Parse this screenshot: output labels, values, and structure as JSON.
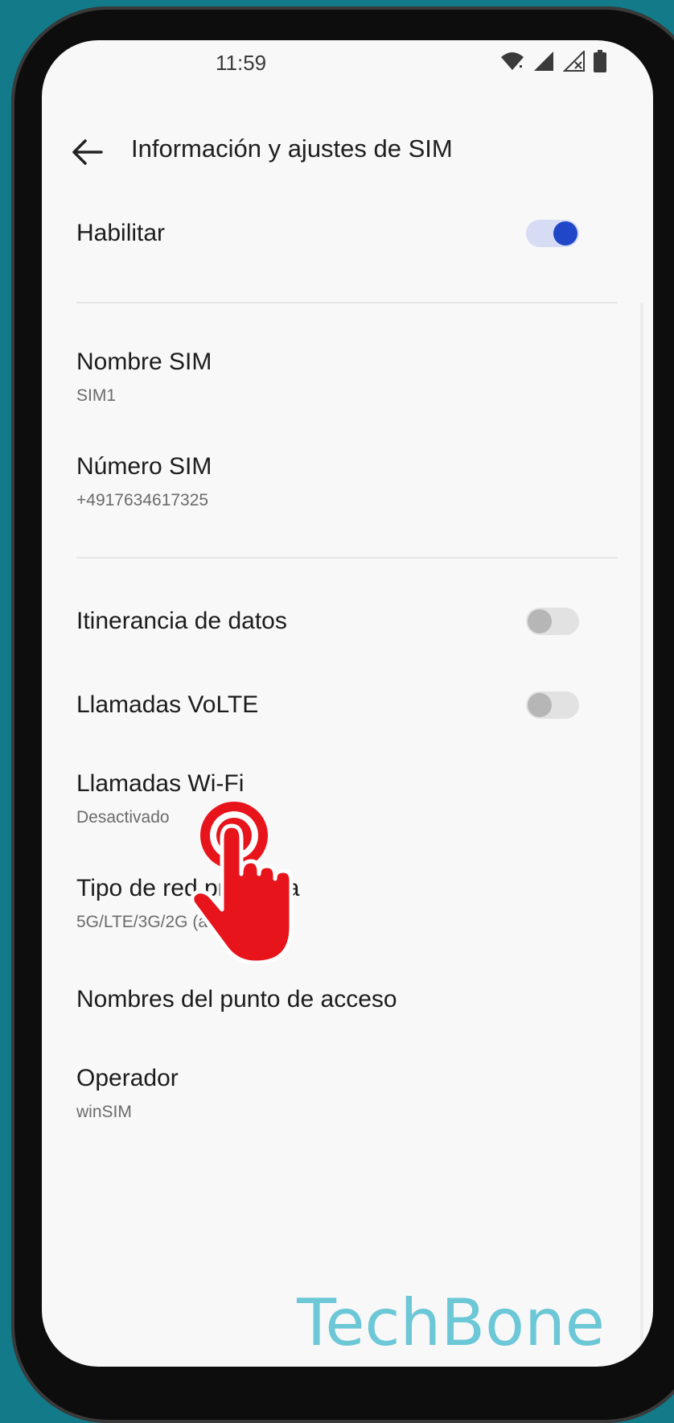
{
  "status_bar": {
    "time": "11:59"
  },
  "header": {
    "title": "Información y ajustes de SIM"
  },
  "settings": {
    "enable": {
      "label": "Habilitar",
      "on": true
    },
    "sim_name": {
      "label": "Nombre SIM",
      "value": "SIM1"
    },
    "sim_number": {
      "label": "Número SIM",
      "value": "+4917634617325"
    },
    "data_roaming": {
      "label": "Itinerancia de datos",
      "on": false
    },
    "volte": {
      "label": "Llamadas VoLTE",
      "on": false
    },
    "wifi_calling": {
      "label": "Llamadas Wi-Fi",
      "value": "Desactivado"
    },
    "network_type": {
      "label": "Tipo de red preferida",
      "value": "5G/LTE/3G/2G (automático)"
    },
    "apn": {
      "label": "Nombres del punto de acceso"
    },
    "operator": {
      "label": "Operador",
      "value": "winSIM"
    }
  },
  "watermark": {
    "text": "TechBone"
  },
  "colors": {
    "accent": "#2047c8",
    "tap_indicator": "#e8141c",
    "watermark": "#6cc7d6"
  },
  "icons": [
    "back-arrow-icon",
    "wifi-icon",
    "signal-icon",
    "signal-no-service-icon",
    "battery-icon",
    "tap-gesture-icon"
  ]
}
